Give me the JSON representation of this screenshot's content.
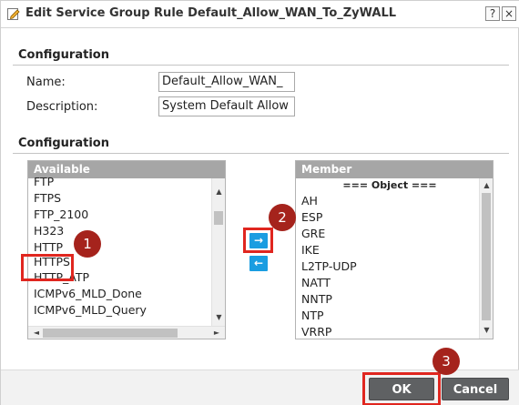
{
  "dialog": {
    "title": "Edit Service Group Rule Default_Allow_WAN_To_ZyWALL",
    "help_label": "?",
    "close_label": "×"
  },
  "config1": {
    "section_title": "Configuration",
    "name_label": "Name:",
    "name_value": "Default_Allow_WAN_",
    "description_label": "Description:",
    "description_value": "System Default Allow"
  },
  "config2": {
    "section_title": "Configuration",
    "available": {
      "header": "Available",
      "items": [
        "FTP",
        "FTPS",
        "FTP_2100",
        "H323",
        "HTTP",
        "HTTPS",
        "HTTP_ATP",
        "ICMPv6_MLD_Done",
        "ICMPv6_MLD_Query"
      ]
    },
    "member": {
      "header": "Member",
      "group_label": "=== Object ===",
      "items": [
        "AH",
        "ESP",
        "GRE",
        "IKE",
        "L2TP-UDP",
        "NATT",
        "NNTP",
        "NTP",
        "VRRP"
      ]
    },
    "add_arrow": "→",
    "remove_arrow": "←"
  },
  "annotations": {
    "step1": "1",
    "step2": "2",
    "step3": "3",
    "highlight_color": "#e0261f",
    "badge_color": "#a5231c"
  },
  "footer": {
    "ok_label": "OK",
    "cancel_label": "Cancel"
  },
  "colors": {
    "accent": "#1a9de1",
    "list_header": "#a6a6a6",
    "button": "#5f6163"
  }
}
